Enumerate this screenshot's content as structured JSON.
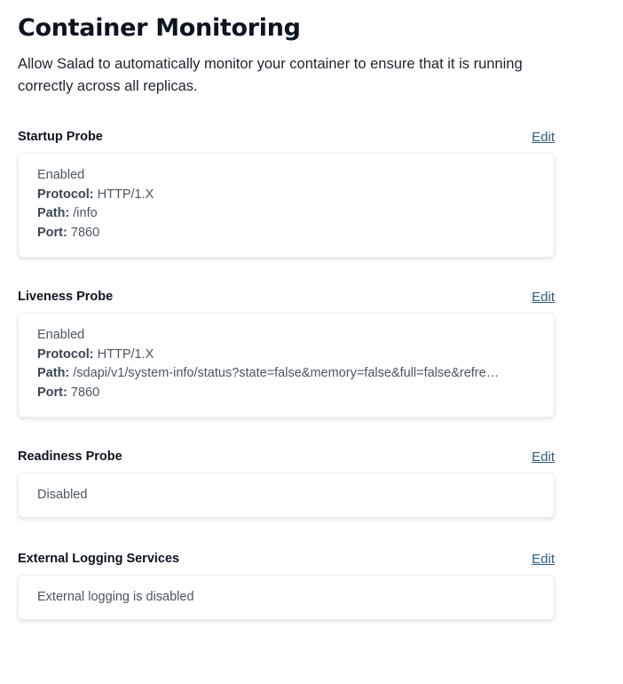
{
  "header": {
    "title": "Container Monitoring",
    "description": "Allow Salad to automatically monitor your container to ensure that it is running correctly across all replicas."
  },
  "labels": {
    "protocol": "Protocol:",
    "path": "Path:",
    "port": "Port:"
  },
  "startup_probe": {
    "title": "Startup Probe",
    "edit_label": "Edit",
    "status": "Enabled",
    "protocol": "HTTP/1.X",
    "path": "/info",
    "port": "7860"
  },
  "liveness_probe": {
    "title": "Liveness Probe",
    "edit_label": "Edit",
    "status": "Enabled",
    "protocol": "HTTP/1.X",
    "path": "/sdapi/v1/system-info/status?state=false&memory=false&full=false&refre…",
    "port": "7860"
  },
  "readiness_probe": {
    "title": "Readiness Probe",
    "edit_label": "Edit",
    "status": "Disabled"
  },
  "external_logging": {
    "title": "External Logging Services",
    "edit_label": "Edit",
    "status": "External logging is disabled"
  },
  "colors": {
    "link": "#2f5a80",
    "heading": "#0b1420",
    "muted_text": "#4a5563"
  }
}
